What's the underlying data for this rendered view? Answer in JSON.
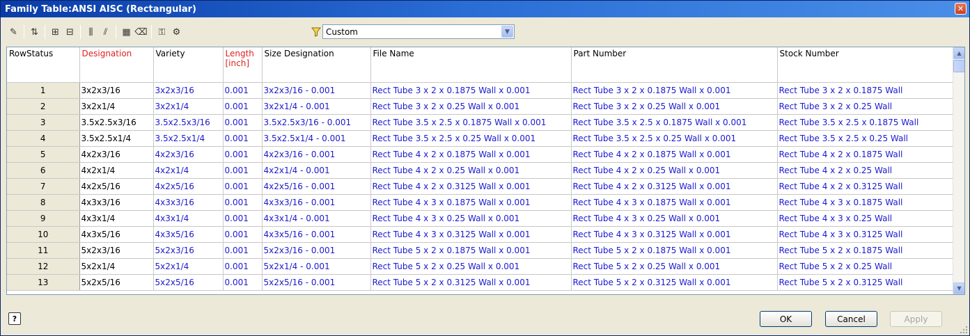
{
  "window": {
    "title": "Family Table:ANSI AISC (Rectangular)"
  },
  "toolbar": {
    "icons": [
      "edit-icon",
      "sort-az-icon",
      "insert-row-icon",
      "delete-row-icon",
      "insert-column-icon",
      "delete-column-icon",
      "properties-icon",
      "clear-icon",
      "key-icon",
      "settings-icon"
    ],
    "filter_value": "Custom"
  },
  "columns": [
    "RowStatus",
    "Designation",
    "Variety",
    "Length\n[inch]",
    "Size Designation",
    "File Name",
    "Part Number",
    "Stock Number"
  ],
  "column_colors": {
    "red": "#e02020",
    "link": "#1a1ad0"
  },
  "rows": [
    [
      "1",
      "3x2x3/16",
      "3x2x3/16",
      "0.001",
      "3x2x3/16 - 0.001",
      "Rect Tube 3 x 2 x 0.1875 Wall x 0.001",
      "Rect Tube 3 x 2 x 0.1875 Wall x 0.001",
      "Rect Tube 3 x 2 x 0.1875 Wall"
    ],
    [
      "2",
      "3x2x1/4",
      "3x2x1/4",
      "0.001",
      "3x2x1/4 - 0.001",
      "Rect Tube 3 x 2 x 0.25 Wall x 0.001",
      "Rect Tube 3 x 2 x 0.25 Wall x 0.001",
      "Rect Tube 3 x 2 x 0.25 Wall"
    ],
    [
      "3",
      "3.5x2.5x3/16",
      "3.5x2.5x3/16",
      "0.001",
      "3.5x2.5x3/16 - 0.001",
      "Rect Tube 3.5 x 2.5 x 0.1875 Wall x 0.001",
      "Rect Tube 3.5 x 2.5 x 0.1875 Wall x 0.001",
      "Rect Tube 3.5 x 2.5 x 0.1875 Wall"
    ],
    [
      "4",
      "3.5x2.5x1/4",
      "3.5x2.5x1/4",
      "0.001",
      "3.5x2.5x1/4 - 0.001",
      "Rect Tube 3.5 x 2.5 x 0.25 Wall x 0.001",
      "Rect Tube 3.5 x 2.5 x 0.25 Wall x 0.001",
      "Rect Tube 3.5 x 2.5 x 0.25 Wall"
    ],
    [
      "5",
      "4x2x3/16",
      "4x2x3/16",
      "0.001",
      "4x2x3/16 - 0.001",
      "Rect Tube 4 x 2 x 0.1875 Wall x 0.001",
      "Rect Tube 4 x 2 x 0.1875 Wall x 0.001",
      "Rect Tube 4 x 2 x 0.1875 Wall"
    ],
    [
      "6",
      "4x2x1/4",
      "4x2x1/4",
      "0.001",
      "4x2x1/4 - 0.001",
      "Rect Tube 4 x 2 x 0.25 Wall x 0.001",
      "Rect Tube 4 x 2 x 0.25 Wall x 0.001",
      "Rect Tube 4 x 2 x 0.25 Wall"
    ],
    [
      "7",
      "4x2x5/16",
      "4x2x5/16",
      "0.001",
      "4x2x5/16 - 0.001",
      "Rect Tube 4 x 2 x 0.3125 Wall x 0.001",
      "Rect Tube 4 x 2 x 0.3125 Wall x 0.001",
      "Rect Tube 4 x 2 x 0.3125 Wall"
    ],
    [
      "8",
      "4x3x3/16",
      "4x3x3/16",
      "0.001",
      "4x3x3/16 - 0.001",
      "Rect Tube 4 x 3 x 0.1875 Wall x 0.001",
      "Rect Tube 4 x 3 x 0.1875 Wall x 0.001",
      "Rect Tube 4 x 3 x 0.1875 Wall"
    ],
    [
      "9",
      "4x3x1/4",
      "4x3x1/4",
      "0.001",
      "4x3x1/4 - 0.001",
      "Rect Tube 4 x 3 x 0.25 Wall x 0.001",
      "Rect Tube 4 x 3 x 0.25 Wall x 0.001",
      "Rect Tube 4 x 3 x 0.25 Wall"
    ],
    [
      "10",
      "4x3x5/16",
      "4x3x5/16",
      "0.001",
      "4x3x5/16 - 0.001",
      "Rect Tube 4 x 3 x 0.3125 Wall x 0.001",
      "Rect Tube 4 x 3 x 0.3125 Wall x 0.001",
      "Rect Tube 4 x 3 x 0.3125 Wall"
    ],
    [
      "11",
      "5x2x3/16",
      "5x2x3/16",
      "0.001",
      "5x2x3/16 - 0.001",
      "Rect Tube 5 x 2 x 0.1875 Wall x 0.001",
      "Rect Tube 5 x 2 x 0.1875 Wall x 0.001",
      "Rect Tube 5 x 2 x 0.1875 Wall"
    ],
    [
      "12",
      "5x2x1/4",
      "5x2x1/4",
      "0.001",
      "5x2x1/4 - 0.001",
      "Rect Tube 5 x 2 x 0.25 Wall x 0.001",
      "Rect Tube 5 x 2 x 0.25 Wall x 0.001",
      "Rect Tube 5 x 2 x 0.25 Wall"
    ],
    [
      "13",
      "5x2x5/16",
      "5x2x5/16",
      "0.001",
      "5x2x5/16 - 0.001",
      "Rect Tube 5 x 2 x 0.3125 Wall x 0.001",
      "Rect Tube 5 x 2 x 0.3125 Wall x 0.001",
      "Rect Tube 5 x 2 x 0.3125 Wall"
    ]
  ],
  "footer": {
    "help_label": "?",
    "ok_label": "OK",
    "cancel_label": "Cancel",
    "apply_label": "Apply"
  }
}
